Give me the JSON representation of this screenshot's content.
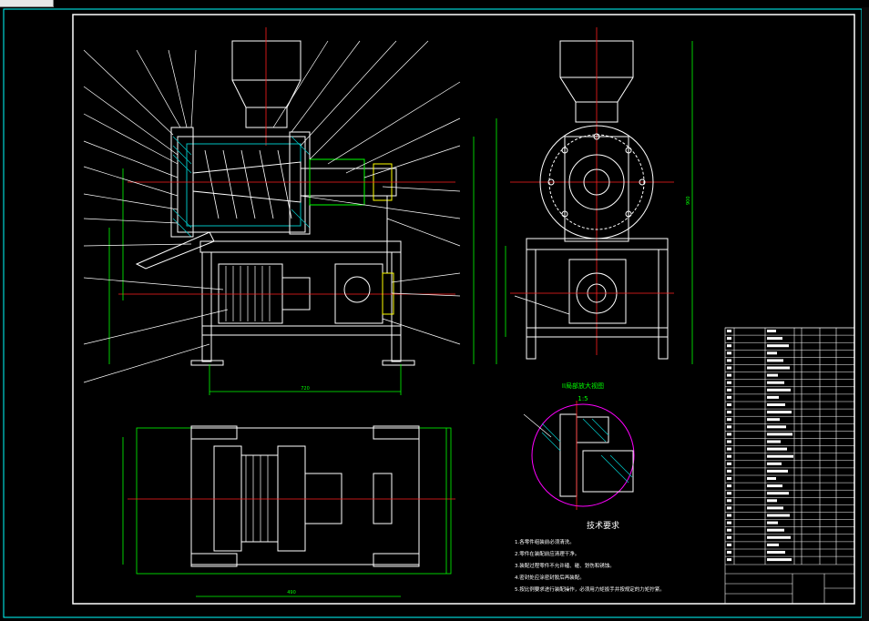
{
  "window": {
    "tab_label": ""
  },
  "detail_view": {
    "title": "II局部放大视图",
    "scale": "1:5"
  },
  "tech_requirements": {
    "heading": "技术要求",
    "items": [
      "1.各零件组装前必须清洗。",
      "2.零件在装配前应清理干净。",
      "3.装配过程零件不允许磕、碰、划伤和锈蚀。",
      "4.密封处应涂密封胶后再装配。",
      "5.按比例要求进行装配操作，必须用力矩扳手并按规定的力矩拧紧。"
    ]
  },
  "dimensions": {
    "front_width": "720",
    "top_width": "490",
    "side_height": "900"
  },
  "colors": {
    "background": "#000000",
    "frame": "#00ffff",
    "centerline": "#ff2020",
    "part": "#ffffff",
    "dimension": "#00ff00",
    "hatch": "#00c0c0",
    "highlight": "#ffff00",
    "circle": "#ff00ff"
  }
}
